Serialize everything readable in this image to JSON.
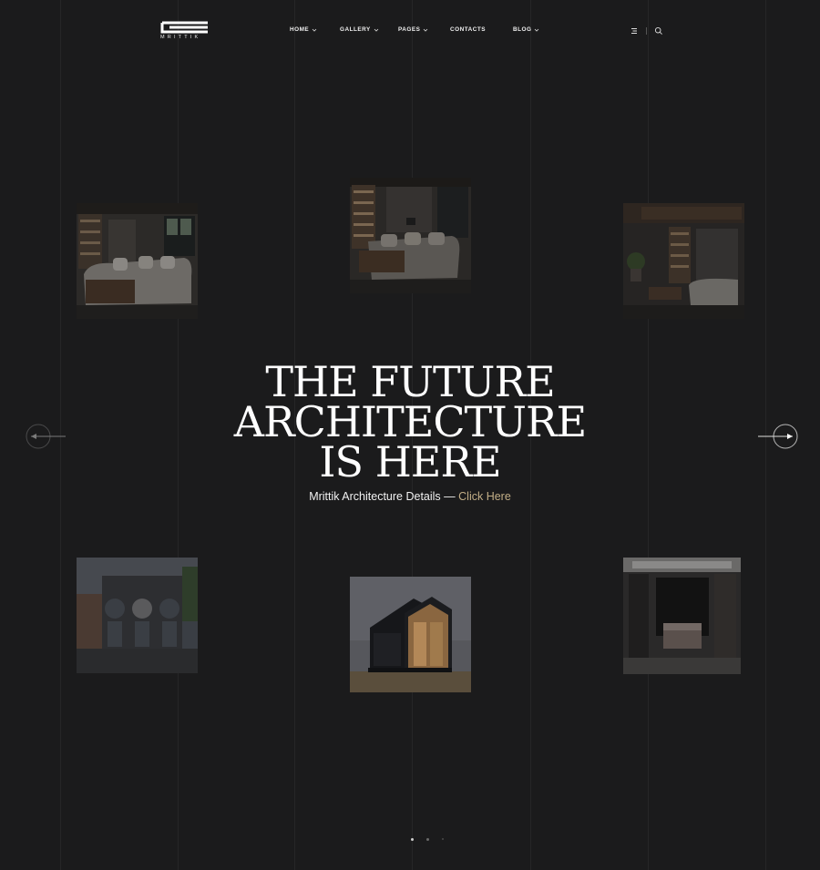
{
  "brand": {
    "name": "MRITTIK"
  },
  "nav": {
    "items": [
      {
        "label": "HOME",
        "has_dropdown": true
      },
      {
        "label": "GALLERY",
        "has_dropdown": true
      },
      {
        "label": "PAGES",
        "has_dropdown": true
      },
      {
        "label": "CONTACTS",
        "has_dropdown": false
      },
      {
        "label": "BLOG",
        "has_dropdown": true
      }
    ]
  },
  "header_icons": [
    "menu-icon",
    "search-icon"
  ],
  "hero": {
    "title_lines": [
      "THE FUTURE",
      "ARCHITECTURE",
      "IS HERE"
    ],
    "subtitle": "Mrittik Architecture Details —",
    "link_text": "Click Here"
  },
  "gallery": [
    {
      "name": "living-room-dark-sofa",
      "icon": "interior-photo"
    },
    {
      "name": "living-room-bookshelf",
      "icon": "interior-photo"
    },
    {
      "name": "lounge-with-plants",
      "icon": "interior-photo"
    },
    {
      "name": "arched-concrete-facade",
      "icon": "exterior-photo"
    },
    {
      "name": "black-cabin-glass-front",
      "icon": "exterior-photo"
    },
    {
      "name": "dark-bedroom",
      "icon": "interior-photo"
    }
  ],
  "slider": {
    "active_dot": 1,
    "dot_count": 3
  },
  "colors": {
    "background": "#1b1b1c",
    "grid_line": "#262627",
    "accent_link": "#c2ae86",
    "text": "#ffffff"
  }
}
